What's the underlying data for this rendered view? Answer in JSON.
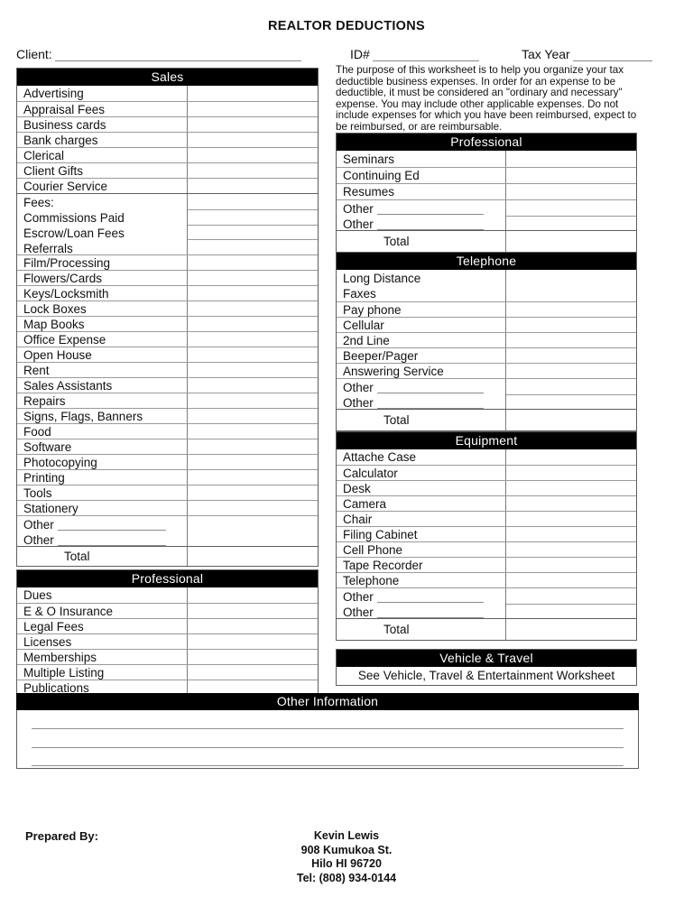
{
  "document": {
    "title": "REALTOR DEDUCTIONS"
  },
  "header_fields": {
    "client_label": "Client:",
    "client_value": "",
    "id_label": "ID#",
    "id_value": "",
    "tax_year_label": "Tax Year",
    "tax_year_value": ""
  },
  "intro": {
    "text": "The purpose of this worksheet is to help you organize your tax deductible business expenses.  In order for an expense to be deductible, it must be considered an \"ordinary and necessary\" expense.  You may include other applicable expenses.  Do not include expenses for which you have been reimbursed, expect to be reimbursed, or are reimbursable."
  },
  "sections": {
    "sales": {
      "heading": "Sales",
      "items_top": [
        "Advertising",
        "Appraisal Fees",
        "Business cards",
        "Bank charges",
        "Clerical",
        "Client Gifts",
        "Courier Service"
      ],
      "fees_group": [
        "Fees:",
        "Commissions Paid",
        "Escrow/Loan Fees",
        "Referrals"
      ],
      "items_bottom": [
        "Film/Processing",
        "Flowers/Cards",
        "Keys/Locksmith",
        "Lock Boxes",
        "Map Books",
        "Office Expense",
        "Open House",
        "Rent",
        "Sales Assistants",
        "Repairs",
        "Signs, Flags, Banners",
        "Food",
        "Software",
        "Photocopying",
        "Printing",
        "Tools",
        "Stationery"
      ],
      "other_label_1": "Other",
      "other_label_2": "Other",
      "total_label": "Total"
    },
    "professional_left": {
      "heading": "Professional",
      "items": [
        "Dues",
        "E & O Insurance",
        "Legal Fees",
        "Licenses",
        "Memberships",
        "Multiple Listing",
        "Publications"
      ]
    },
    "professional_right": {
      "heading": "Professional",
      "items": [
        "Seminars",
        "Continuing Ed",
        "Resumes"
      ],
      "other_label_1": "Other",
      "other_label_2": "Other",
      "total_label": "Total"
    },
    "telephone": {
      "heading": "Telephone",
      "pair_items": [
        "Long Distance",
        "Faxes"
      ],
      "items": [
        "Pay phone",
        "Cellular",
        "2nd Line",
        "Beeper/Pager",
        "Answering Service"
      ],
      "other_label_1": "Other",
      "other_label_2": "Other",
      "total_label": "Total"
    },
    "equipment": {
      "heading": "Equipment",
      "items": [
        "Attache Case",
        "Calculator",
        "Desk",
        "Camera",
        "Chair",
        "Filing Cabinet",
        "Cell Phone",
        "Tape Recorder",
        "Telephone"
      ],
      "other_label_1": "Other",
      "other_label_2": "Other",
      "total_label": "Total"
    },
    "vehicle_travel": {
      "heading": "Vehicle & Travel",
      "note": "See Vehicle, Travel & Entertainment Worksheet"
    },
    "other_information": {
      "heading": "Other Information",
      "line_1": "",
      "line_2": "",
      "line_3": ""
    }
  },
  "footer": {
    "prepared_by_label": "Prepared By:",
    "preparer_name": "Kevin Lewis",
    "preparer_street": "908 Kumukoa St.",
    "preparer_city_state_zip": "Hilo HI 96720",
    "preparer_phone": "Tel: (808) 934-0144"
  },
  "colors": {
    "heading_bg": "#000000",
    "heading_fg": "#ffffff",
    "border": "#5d5d5d",
    "rule": "#9a9a9a"
  }
}
